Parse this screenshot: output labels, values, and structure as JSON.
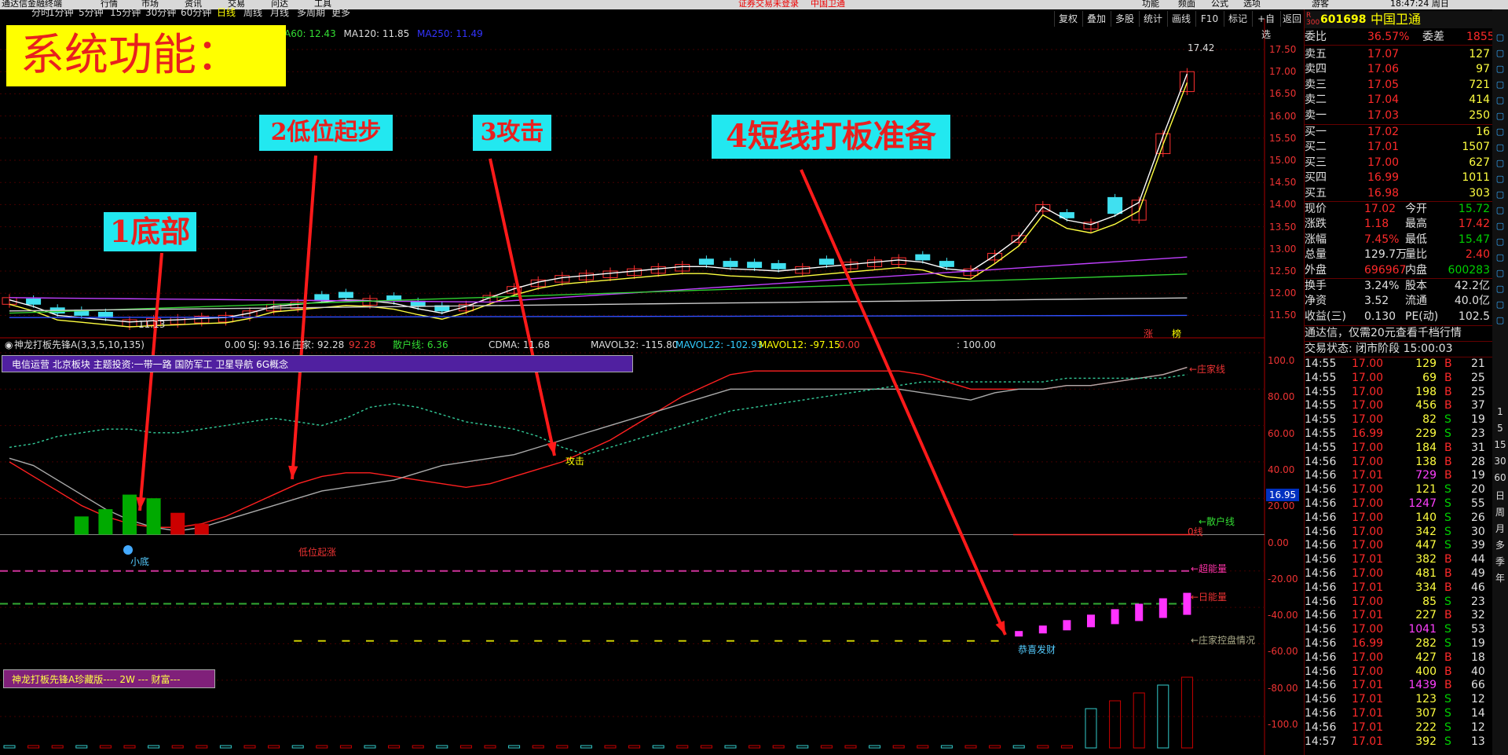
{
  "menubar": {
    "items": [
      "通达信金融终端",
      "行情",
      "市场",
      "资讯",
      "交易",
      "问达",
      "工具"
    ],
    "center_text": "证券交易未登录",
    "center_text2": "中国卫通",
    "right_items": [
      "功能",
      "频面",
      "公式",
      "选项",
      "游客"
    ],
    "clock": "18:47:24 周日"
  },
  "topbar": {
    "periods": [
      "分时",
      "1分钟",
      "5分钟",
      "15分钟",
      "30分钟",
      "60分钟",
      "日线",
      "周线",
      "月线",
      "多周期",
      "更多"
    ],
    "buttons": [
      "复权",
      "叠加",
      "多股",
      "统计",
      "画线",
      "F10",
      "标记",
      "+自选",
      "返回"
    ]
  },
  "ma_legend": {
    "ma60_label": "A60: ",
    "ma60_value": "12.43",
    "ma120_label": "MA120: ",
    "ma120_value": "11.85",
    "ma250_label": "MA250: ",
    "ma250_value": "11.49"
  },
  "title_banner": "系统功能：",
  "annotations": {
    "bottom": "1底部",
    "low_start": "2低位起步",
    "attack": "3攻击",
    "board": "4短线打板准备"
  },
  "price_chart": {
    "high_label": "17.42",
    "low_label": "11.13",
    "yticks": [
      "17.50",
      "17.00",
      "16.50",
      "16.00",
      "15.50",
      "15.00",
      "14.50",
      "14.00",
      "13.50",
      "13.00",
      "12.50",
      "12.00",
      "11.50"
    ],
    "zhang": "涨",
    "bottom_right": "榜"
  },
  "indicator": {
    "name": "神龙打板先锋A(3,3,5,10,135)",
    "v1": "0.00",
    "sj": "SJ: 93.16",
    "zhuangjia": "庄家: 92.28",
    "zhuangjia_val": "92.28",
    "sanhu": "散户线: 6.36",
    "cdma": "CDMA: 11.68",
    "mavol32": "MAVOL32: -115.80",
    "mavol22": "MAVOL22: -102.93",
    "mavol12": "MAVOL12: -97.15",
    "zero": "0.00",
    "hundred": ": 100.00",
    "info_box": "电信运营 北京板块 主题投资:一带一路 国防军工 卫星导航 6G概念",
    "yticks": [
      "100.0",
      "80.00",
      "60.00",
      "40.00",
      "20.00",
      "0.00",
      "-20.00",
      "-40.00",
      "-60.00",
      "-80.00",
      "-100.0"
    ],
    "price_marker": "16.95",
    "labels": {
      "zhuangjia_line": "←庄家线",
      "sanhu_line": "←散户线",
      "zero_line": "0线",
      "chao_neng": "←超能量",
      "ri_neng": "←日能量",
      "kongpan": "←庄家控盘情况"
    },
    "signals": {
      "xiaodi": "小底",
      "diwei": "低位起涨",
      "gongji": "攻击",
      "gongxi": "恭喜发财"
    },
    "bottom_box": "神龙打板先锋A珍藏版----  2W  --- 财富---"
  },
  "quote": {
    "code": "601698",
    "name": "中国卫通",
    "weibi_label": "委比",
    "weibi": "36.57%",
    "weicha_label": "委差",
    "weicha": "1855",
    "asks": [
      {
        "label": "卖五",
        "price": "17.07",
        "vol": "127"
      },
      {
        "label": "卖四",
        "price": "17.06",
        "vol": "97"
      },
      {
        "label": "卖三",
        "price": "17.05",
        "vol": "721"
      },
      {
        "label": "卖二",
        "price": "17.04",
        "vol": "414"
      },
      {
        "label": "卖一",
        "price": "17.03",
        "vol": "250"
      }
    ],
    "bids": [
      {
        "label": "买一",
        "price": "17.02",
        "vol": "16"
      },
      {
        "label": "买二",
        "price": "17.01",
        "vol": "1507"
      },
      {
        "label": "买三",
        "price": "17.00",
        "vol": "627"
      },
      {
        "label": "买四",
        "price": "16.99",
        "vol": "1011"
      },
      {
        "label": "买五",
        "price": "16.98",
        "vol": "303"
      }
    ],
    "stats": [
      {
        "l1": "现价",
        "v1": "17.02",
        "c1": "red",
        "l2": "今开",
        "v2": "15.72",
        "c2": "grn"
      },
      {
        "l1": "涨跌",
        "v1": "1.18",
        "c1": "red",
        "l2": "最高",
        "v2": "17.42",
        "c2": "red"
      },
      {
        "l1": "涨幅",
        "v1": "7.45%",
        "c1": "red",
        "l2": "最低",
        "v2": "15.47",
        "c2": "grn"
      },
      {
        "l1": "总量",
        "v1": "129.7万",
        "c1": "wht",
        "l2": "量比",
        "v2": "2.40",
        "c2": "red"
      },
      {
        "l1": "外盘",
        "v1": "696967",
        "c1": "red",
        "l2": "内盘",
        "v2": "600283",
        "c2": "grn"
      }
    ],
    "fin": [
      {
        "l1": "换手",
        "v1": "3.24%",
        "l2": "股本",
        "v2": "42.2亿"
      },
      {
        "l1": "净资",
        "v1": "3.52",
        "l2": "流通",
        "v2": "40.0亿"
      },
      {
        "l1": "收益(三)",
        "v1": "0.130",
        "l2": "PE(动)",
        "v2": "102.5"
      }
    ],
    "promo": "通达信，仅需20元查看千档行情",
    "status": "交易状态: 闭市阶段 15:00:03",
    "trades": [
      [
        "14:55",
        "17.00",
        "129",
        "B",
        "21"
      ],
      [
        "14:55",
        "17.00",
        "69",
        "B",
        "25"
      ],
      [
        "14:55",
        "17.00",
        "198",
        "B",
        "25"
      ],
      [
        "14:55",
        "17.00",
        "456",
        "B",
        "37"
      ],
      [
        "14:55",
        "17.00",
        "82",
        "S",
        "19"
      ],
      [
        "14:55",
        "16.99",
        "229",
        "S",
        "23"
      ],
      [
        "14:55",
        "17.00",
        "184",
        "B",
        "31"
      ],
      [
        "14:56",
        "17.00",
        "138",
        "B",
        "28"
      ],
      [
        "14:56",
        "17.01",
        "729",
        "B",
        "19"
      ],
      [
        "14:56",
        "17.00",
        "121",
        "S",
        "20"
      ],
      [
        "14:56",
        "17.00",
        "1247",
        "S",
        "55"
      ],
      [
        "14:56",
        "17.00",
        "140",
        "S",
        "26"
      ],
      [
        "14:56",
        "17.00",
        "342",
        "S",
        "30"
      ],
      [
        "14:56",
        "17.00",
        "447",
        "S",
        "39"
      ],
      [
        "14:56",
        "17.01",
        "382",
        "B",
        "44"
      ],
      [
        "14:56",
        "17.00",
        "481",
        "B",
        "49"
      ],
      [
        "14:56",
        "17.01",
        "334",
        "B",
        "46"
      ],
      [
        "14:56",
        "17.00",
        "85",
        "S",
        "23"
      ],
      [
        "14:56",
        "17.01",
        "227",
        "B",
        "32"
      ],
      [
        "14:56",
        "17.00",
        "1041",
        "S",
        "53"
      ],
      [
        "14:56",
        "16.99",
        "282",
        "S",
        "19"
      ],
      [
        "14:56",
        "17.00",
        "427",
        "B",
        "18"
      ],
      [
        "14:56",
        "17.00",
        "400",
        "B",
        "40"
      ],
      [
        "14:56",
        "17.01",
        "1439",
        "B",
        "66"
      ],
      [
        "14:56",
        "17.01",
        "123",
        "S",
        "12"
      ],
      [
        "14:56",
        "17.01",
        "307",
        "S",
        "14"
      ],
      [
        "14:56",
        "17.01",
        "222",
        "S",
        "12"
      ],
      [
        "14:57",
        "17.01",
        "392",
        "S",
        "13"
      ]
    ]
  },
  "side_strip": [
    "1",
    "5",
    "15",
    "30",
    "60",
    "日",
    "周",
    "月",
    "多",
    "季",
    "年"
  ]
}
